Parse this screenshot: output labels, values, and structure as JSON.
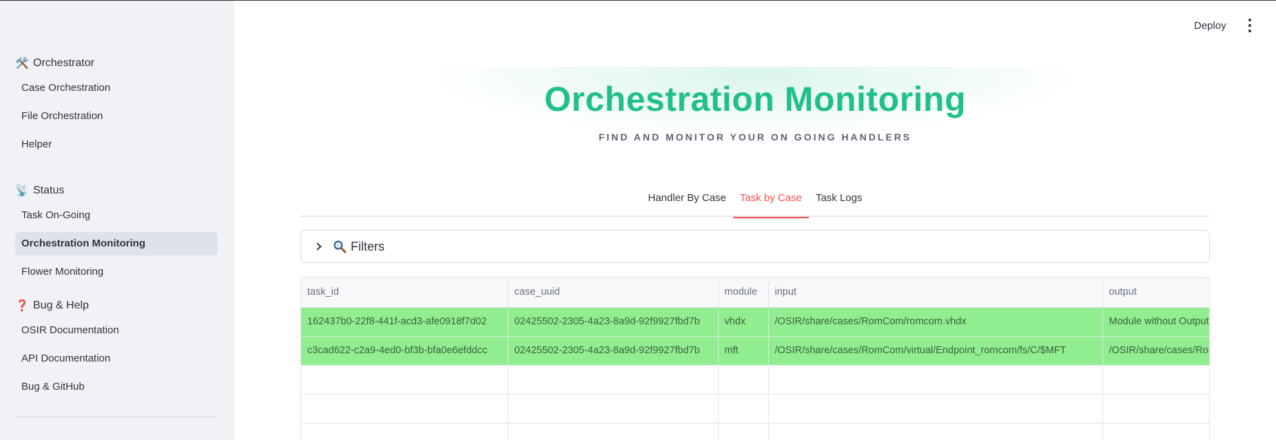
{
  "sidebar": {
    "groups": [
      {
        "header": "Orchestrator",
        "emoji": "🛠️",
        "items": [
          "Case Orchestration",
          "File Orchestration",
          "Helper"
        ]
      },
      {
        "header": "Status",
        "emoji": "📡",
        "items": [
          "Task On-Going",
          "Orchestration Monitoring",
          "Flower Monitoring"
        ]
      },
      {
        "header": "Bug & Help",
        "emoji": "❓",
        "items": [
          "OSIR Documentation",
          "API Documentation",
          "Bug & GitHub"
        ]
      }
    ],
    "active_item": "Orchestration Monitoring"
  },
  "topbar": {
    "deploy_label": "Deploy"
  },
  "hero": {
    "title": "Orchestration Monitoring",
    "subtitle": "FIND AND MONITOR YOUR ON GOING HANDLERS",
    "title_color": "#21c08b"
  },
  "tabs": [
    "Handler By Case",
    "Task by Case",
    "Task Logs"
  ],
  "active_tab": "Task by Case",
  "filters": {
    "label": "Filters",
    "icon": "magnifier-icon"
  },
  "table": {
    "columns": [
      "task_id",
      "case_uuid",
      "module",
      "input",
      "output"
    ],
    "rows": [
      [
        "162437b0-22f8-441f-acd3-afe0918f7d02",
        "02425502-2305-4a23-8a9d-92f9927fbd7b",
        "vhdx",
        "/OSIR/share/cases/RomCom/romcom.vhdx",
        "Module without Output"
      ],
      [
        "c3cad622-c2a9-4ed0-bf3b-bfa0e6efddcc",
        "02425502-2305-4a23-8a9d-92f9927fbd7b",
        "mft",
        "/OSIR/share/cases/RomCom/virtual/Endpoint_romcom/fs/C/$MFT",
        "/OSIR/share/cases/RomCom"
      ]
    ],
    "row_highlight_color": "#90ee90"
  },
  "colors": {
    "accent_red": "#ff4b4b",
    "sidebar_bg": "#f0f2f6"
  }
}
